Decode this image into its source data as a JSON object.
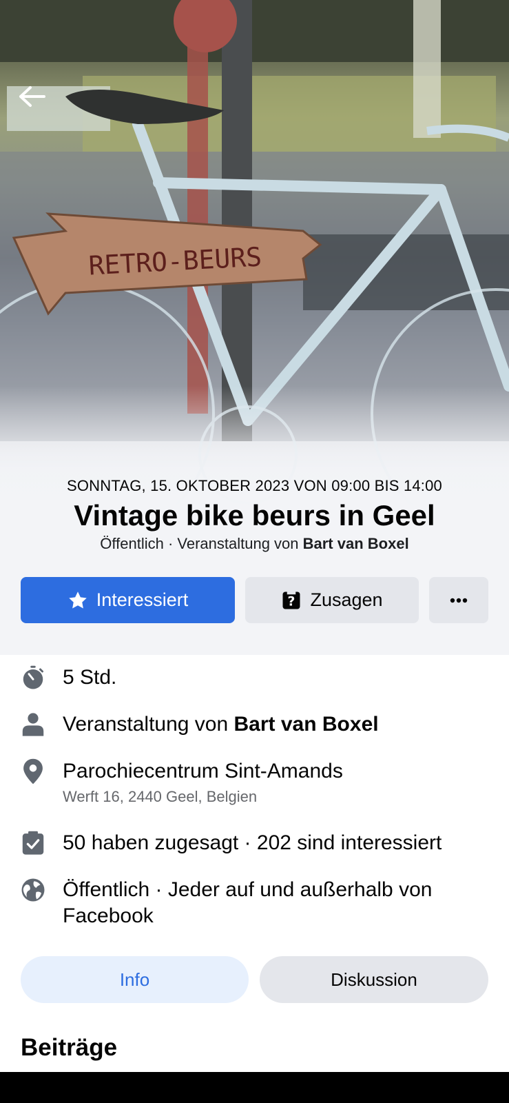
{
  "cover": {
    "sign_text": "RETRO-BEURS"
  },
  "header": {
    "date_line": "SONNTAG, 15. OKTOBER 2023 VON 09:00 BIS 14:00",
    "title": "Vintage bike beurs in Geel",
    "privacy_prefix": "Öffentlich · Veranstaltung von ",
    "host": "Bart van Boxel"
  },
  "actions": {
    "interested_label": "Interessiert",
    "going_label": "Zusagen",
    "more_label": "···"
  },
  "details": {
    "duration": "5 Std.",
    "host_prefix": "Veranstaltung von ",
    "host_name": "Bart van Boxel",
    "location_name": "Parochiecentrum Sint-Amands",
    "location_address": "Werft 16, 2440 Geel, Belgien",
    "responses": "50 haben zugesagt · 202 sind interessiert",
    "privacy": "Öffentlich · Jeder auf und außerhalb von Facebook"
  },
  "tabs": {
    "info": "Info",
    "discussion": "Diskussion"
  },
  "section": {
    "posts_title": "Beiträge"
  },
  "colors": {
    "primary_blue": "#2d6de0",
    "button_gray": "#e4e6eb",
    "info_tab_bg": "#e7f0fd",
    "secondary_text": "#65676b"
  },
  "icons": {
    "back": "arrow-left-icon",
    "interested": "star-icon",
    "going": "question-calendar-icon",
    "more": "more-dots-icon",
    "duration": "stopwatch-icon",
    "host": "person-icon",
    "location": "map-pin-icon",
    "responses": "checkbox-icon",
    "privacy": "globe-icon"
  }
}
